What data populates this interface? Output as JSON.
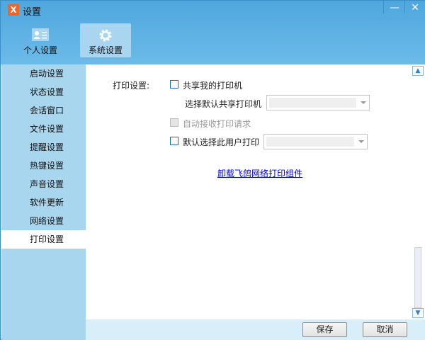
{
  "window": {
    "title": "设置",
    "logo": "X",
    "minimize": "—",
    "close": "✕"
  },
  "tabs": [
    {
      "label": "个人设置",
      "icon": "id-card-icon"
    },
    {
      "label": "系统设置",
      "icon": "gear-icon"
    }
  ],
  "sidebar": {
    "items": [
      {
        "label": "启动设置"
      },
      {
        "label": "状态设置"
      },
      {
        "label": "会话窗口"
      },
      {
        "label": "文件设置"
      },
      {
        "label": "提醒设置"
      },
      {
        "label": "热键设置"
      },
      {
        "label": "声音设置"
      },
      {
        "label": "软件更新"
      },
      {
        "label": "网络设置"
      },
      {
        "label": "打印设置"
      }
    ],
    "active": 9
  },
  "print": {
    "section_label": "打印设置:",
    "share_printer": "共享我的打印机",
    "select_default_shared": "选择默认共享打印机",
    "auto_accept": "自动接收打印请求",
    "default_user_print": "默认选择此用户打印",
    "uninstall_link": "卸载飞鸽网络打印组件"
  },
  "footer": {
    "save": "保存",
    "cancel": "取消"
  }
}
